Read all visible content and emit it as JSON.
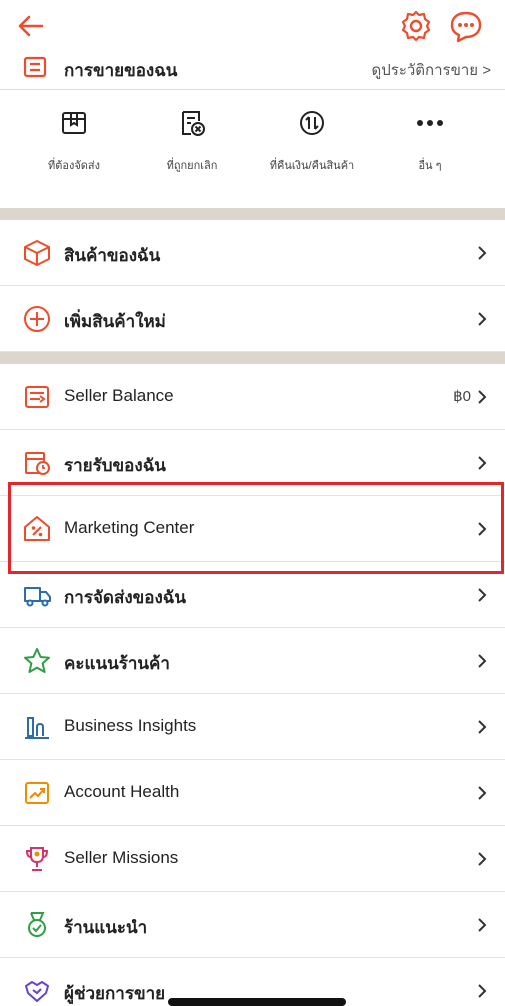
{
  "colors": {
    "accent": "#ee4d2d",
    "highlight": "#e3262a"
  },
  "topbar": {
    "back_icon": "back-arrow-icon",
    "settings_icon": "gear-icon",
    "chat_icon": "chat-icon"
  },
  "sales": {
    "title": "การขายของฉน",
    "history_link": "ดูประวัติการขาย >"
  },
  "shortcuts": [
    {
      "label": "ที่ต้องจัดส่ง",
      "icon": "package-icon"
    },
    {
      "label": "ที่ถูกยกเลิก",
      "icon": "cancelled-order-icon"
    },
    {
      "label": "ที่คืนเงิน/คืนสินค้า",
      "icon": "refund-icon"
    },
    {
      "label": "อื่น ๆ",
      "icon": "more-icon"
    }
  ],
  "rows": [
    {
      "label": "สินค้าของฉัน",
      "icon": "box-icon"
    },
    {
      "label": "เพิ่มสินค้าใหม่",
      "icon": "add-circle-icon"
    },
    {
      "label": "Seller Balance",
      "icon": "wallet-icon",
      "value": "฿0"
    },
    {
      "label": "รายรับของฉัน",
      "icon": "income-icon"
    },
    {
      "label": "Marketing Center",
      "icon": "marketing-icon"
    },
    {
      "label": "การจัดส่งของฉัน",
      "icon": "truck-icon"
    },
    {
      "label": "คะแนนร้านค้า",
      "icon": "star-icon"
    },
    {
      "label": "Business Insights",
      "icon": "chart-icon"
    },
    {
      "label": "Account Health",
      "icon": "health-icon"
    },
    {
      "label": "Seller Missions",
      "icon": "trophy-icon"
    },
    {
      "label": "ร้านแนะนำ",
      "icon": "medal-icon"
    },
    {
      "label": "ผู้ช่วยการขาย",
      "icon": "handshake-icon"
    }
  ]
}
